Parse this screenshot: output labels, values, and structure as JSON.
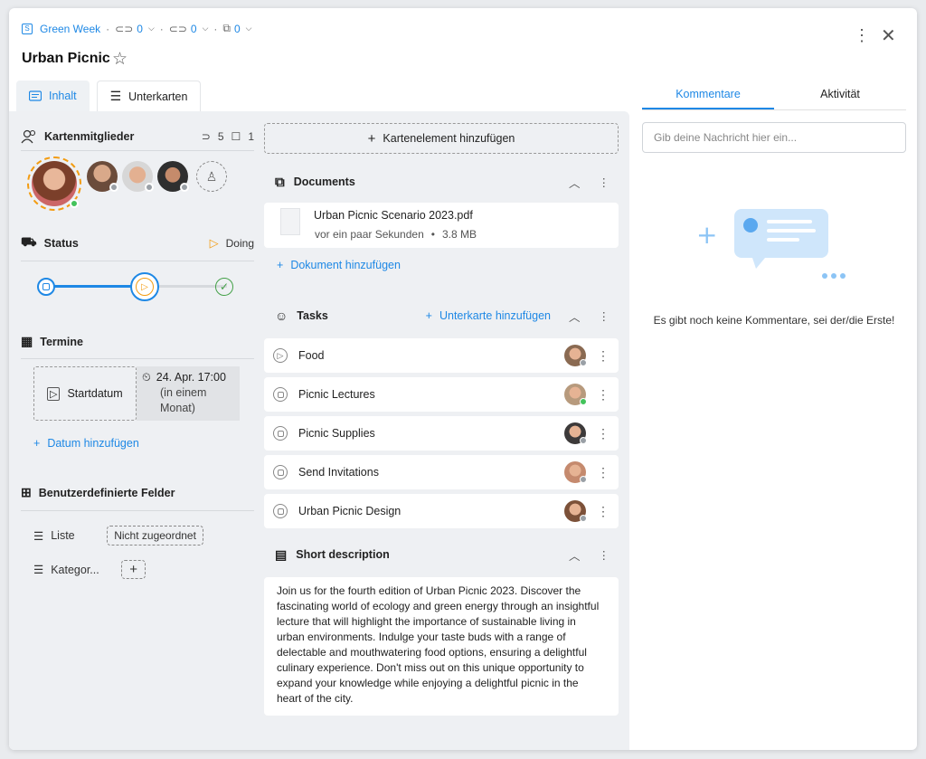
{
  "header": {
    "board": "Green Week",
    "count_a": "0",
    "count_b": "0",
    "count_c": "0",
    "title": "Urban Picnic"
  },
  "tabs": {
    "inhalt": "Inhalt",
    "unterkarten": "Unterkarten"
  },
  "members": {
    "label": "Kartenmitglieder",
    "watchers": "5",
    "comments": "1"
  },
  "status": {
    "label": "Status",
    "value": "Doing"
  },
  "termine": {
    "label": "Termine",
    "start_label": "Startdatum",
    "date": "24. Apr. 17:00",
    "relative_1": "(in einem",
    "relative_2": "Monat)",
    "add": "Datum hinzufügen"
  },
  "custom_fields": {
    "label": "Benutzerdefinierte Felder",
    "liste_label": "Liste",
    "liste_value": "Nicht zugeordnet",
    "kategorie_label": "Kategor..."
  },
  "add_element": "Kartenelement hinzufügen",
  "documents": {
    "label": "Documents",
    "file_name": "Urban Picnic Scenario 2023.pdf",
    "file_time": "vor ein paar Sekunden",
    "file_size": "3.8 MB",
    "add": "Dokument hinzufügen"
  },
  "tasks": {
    "label": "Tasks",
    "add": "Unterkarte hinzufügen",
    "items": [
      {
        "name": "Food",
        "status": "play",
        "avatar_color": "#8a6a52",
        "online": false
      },
      {
        "name": "Picnic Lectures",
        "status": "todo",
        "avatar_color": "#b79a7d",
        "online": true
      },
      {
        "name": "Picnic Supplies",
        "status": "todo",
        "avatar_color": "#3d3a3a",
        "online": false
      },
      {
        "name": "Send Invitations",
        "status": "todo",
        "avatar_color": "#c58a6e",
        "online": false
      },
      {
        "name": "Urban Picnic Design",
        "status": "todo",
        "avatar_color": "#7c5139",
        "online": false
      }
    ]
  },
  "description": {
    "label": "Short description",
    "text": "Join us for the fourth edition of Urban Picnic 2023. Discover the fascinating world of ecology and green energy through an insightful lecture that will highlight the importance of sustainable living in urban environments. Indulge your taste buds with a range of delectable and mouthwatering food options, ensuring a delightful culinary experience. Don't miss out on this unique opportunity to expand your knowledge while enjoying a delightful picnic in the heart of the city."
  },
  "side": {
    "tab_comments": "Kommentare",
    "tab_activity": "Aktivität",
    "input_placeholder": "Gib deine Nachricht hier ein...",
    "empty_text": "Es gibt noch keine Kommentare, sei der/die Erste!"
  },
  "colors": {
    "accent": "#1e88e5",
    "status_orange": "#f39c12",
    "done_green": "#43a047"
  }
}
